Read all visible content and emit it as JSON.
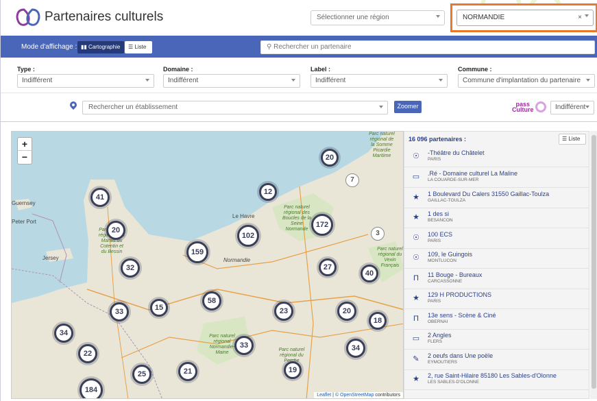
{
  "header": {
    "title": "Partenaires culturels",
    "region_placeholder": "Sélectionner une région",
    "selected_region": "NORMANDIE",
    "clear_symbol": "×"
  },
  "toolbar": {
    "mode_label": "Mode d'affichage :",
    "carto_label": "Cartographie",
    "liste_label": "Liste",
    "search_placeholder": "Rechercher un partenaire"
  },
  "filters": [
    {
      "label": "Type :",
      "value": "Indifférent"
    },
    {
      "label": "Domaine :",
      "value": "Indifférent"
    },
    {
      "label": "Label :",
      "value": "Indifférent"
    },
    {
      "label": "Commune :",
      "value": "Commune d'implantation du partenaire"
    }
  ],
  "establishment": {
    "placeholder": "Rechercher un établissement",
    "zoom_label": "Zoomer",
    "pass_culture_top": "pass",
    "pass_culture_bottom": "Culture",
    "pass_select": "Indifférent"
  },
  "map": {
    "zoom_in": "+",
    "zoom_out": "−",
    "clusters": [
      {
        "value": "20"
      },
      {
        "value": "7"
      },
      {
        "value": "12"
      },
      {
        "value": "41"
      },
      {
        "value": "172"
      },
      {
        "value": "20"
      },
      {
        "value": "102"
      },
      {
        "value": "3"
      },
      {
        "value": "159"
      },
      {
        "value": "32"
      },
      {
        "value": "27"
      },
      {
        "value": "40"
      },
      {
        "value": "58"
      },
      {
        "value": "15"
      },
      {
        "value": "33"
      },
      {
        "value": "23"
      },
      {
        "value": "20"
      },
      {
        "value": "18"
      },
      {
        "value": "34"
      },
      {
        "value": "33"
      },
      {
        "value": "34"
      },
      {
        "value": "22"
      },
      {
        "value": "21"
      },
      {
        "value": "25"
      },
      {
        "value": "19"
      },
      {
        "value": "184"
      }
    ],
    "labels": {
      "guernsey": "Guernsey",
      "peter_port": "Peter Port",
      "jersey": "Jersey",
      "le_havre": "Le Havre",
      "normandie": "Normandie",
      "park1": "Parc naturel régional des Boucles de la Seine Normande",
      "park2": "Parc naturel régional du Perche",
      "park3": "Parc naturel régional Normandie-Maine",
      "park4": "Parc naturel régional du Vexin Français",
      "park5": "Parc naturel régional des Marais du Cotentin et du Bessin",
      "park6": "Parc naturel régional de la Somme Picardie Maritime"
    },
    "attribution_leaflet": "Leaflet",
    "attribution_osm": "© OpenStreetMap",
    "attribution_rest": "contributors"
  },
  "results": {
    "count_label": "16 096 partenaires :",
    "liste_button": "Liste",
    "items": [
      {
        "name": "-Théâtre du Châtelet",
        "city": "PARIS",
        "icon": "masks-icon"
      },
      {
        "name": ".Ré - Domaine culturel La Maline",
        "city": "LA COUARDE-SUR-MER",
        "icon": "screen-icon"
      },
      {
        "name": "1 Boulevard Du Calers 31550 Gaillac-Toulza",
        "city": "GAILLAC-TOULZA",
        "icon": "star-icon"
      },
      {
        "name": "1 des si",
        "city": "BESANCON",
        "icon": "star-icon"
      },
      {
        "name": "100 ECS",
        "city": "PARIS",
        "icon": "masks-icon"
      },
      {
        "name": "109, le Guingois",
        "city": "MONTLUCON",
        "icon": "masks-icon"
      },
      {
        "name": "11 Bouge - Bureaux",
        "city": "CARCASSONNE",
        "icon": "monument-icon"
      },
      {
        "name": "129 H PRODUCTIONS",
        "city": "PARIS",
        "icon": "star-icon"
      },
      {
        "name": "13e sens - Scène & Ciné",
        "city": "OBERNAI",
        "icon": "monument-icon"
      },
      {
        "name": "2 Angles",
        "city": "FLERS",
        "icon": "screen-icon"
      },
      {
        "name": "2 oeufs dans Une poële",
        "city": "EYMOUTIERS",
        "icon": "paint-icon"
      },
      {
        "name": "2, rue Saint-Hilaire 85180 Les Sables-d'Olonne",
        "city": "LES SABLES-D'OLONNE",
        "icon": "star-icon"
      }
    ]
  },
  "colors": {
    "primary_blue": "#4a66b8",
    "dark_blue": "#263a7a",
    "highlight_orange": "#e8792a",
    "pass_culture_purple": "#9b2c9c"
  }
}
